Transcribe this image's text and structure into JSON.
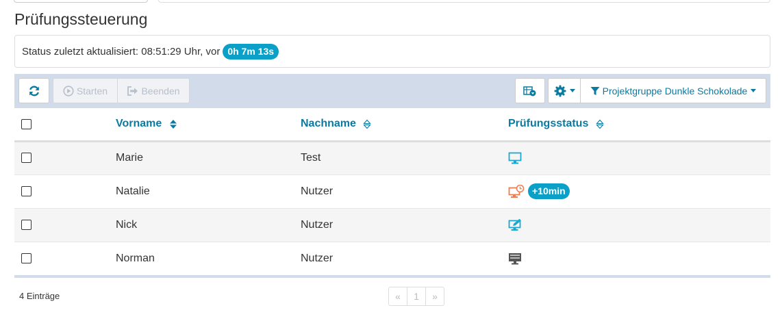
{
  "page": {
    "title": "Prüfungssteuerung"
  },
  "status": {
    "prefix": "Status zuletzt aktualisiert: 08:51:29 Uhr, vor",
    "elapsed": "0h 7m 13s"
  },
  "toolbar": {
    "refresh_icon": "refresh-icon",
    "start_label": "Starten",
    "end_label": "Beenden",
    "export_icon": "export-icon",
    "settings_icon": "gear-icon",
    "filter_label": "Projektgruppe Dunkle Schokolade"
  },
  "table": {
    "columns": {
      "firstname": "Vorname",
      "lastname": "Nachname",
      "status": "Prüfungsstatus"
    },
    "rows": [
      {
        "firstname": "Marie",
        "lastname": "Test",
        "status_icon": "monitor-icon",
        "extra": ""
      },
      {
        "firstname": "Natalie",
        "lastname": "Nutzer",
        "status_icon": "monitor-clock-icon",
        "extra": "+10min"
      },
      {
        "firstname": "Nick",
        "lastname": "Nutzer",
        "status_icon": "monitor-edit-icon",
        "extra": ""
      },
      {
        "firstname": "Norman",
        "lastname": "Nutzer",
        "status_icon": "monitor-inactive-icon",
        "extra": ""
      }
    ]
  },
  "footer": {
    "count": "4 Einträge",
    "pager": {
      "prev": "«",
      "page": "1",
      "next": "»"
    }
  },
  "colors": {
    "accent": "#0aa0c8",
    "link": "#0a7aa0",
    "toolbar_bg": "#d2dbe9",
    "warning": "#f07c50"
  }
}
